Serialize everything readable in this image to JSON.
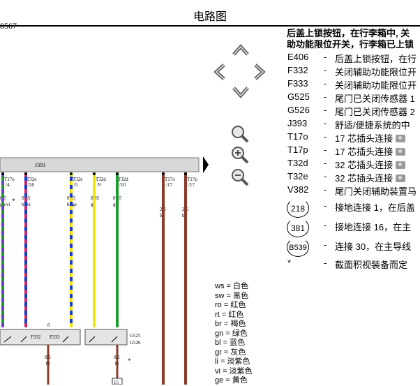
{
  "header": {
    "title": "电路图",
    "doc_number": "8567"
  },
  "diagram": {
    "module_label": "J393",
    "pins": [
      {
        "conn": "T17o",
        "pin": "/4"
      },
      {
        "conn": "T32e",
        "pin": "/20"
      },
      {
        "conn": "T32e",
        "pin": "/5"
      },
      {
        "conn": "T32d",
        "pin": "/9"
      },
      {
        "conn": "T32d",
        "pin": "/10"
      },
      {
        "conn": "T17o",
        "pin": "/17"
      },
      {
        "conn": "T17p",
        "pin": "/17"
      }
    ],
    "wires": [
      {
        "size": "0.35",
        "color": "bl/vi"
      },
      {
        "size": "0.35",
        "color": "bl/ge"
      },
      {
        "size": "0.35",
        "color": "ge"
      },
      {
        "size": "0.35",
        "color": "gn"
      },
      {
        "size": "2.5",
        "color": "br"
      },
      {
        "size": "2.5",
        "color": "br"
      }
    ],
    "left_wire_size": "0.5",
    "left_wire_color": "gn/vi",
    "asterisk": "*",
    "switch_labels": [
      "F332",
      "F333"
    ],
    "sensor_labels": [
      "G525",
      "G526"
    ],
    "lower_wires": [
      {
        "size": "0.5",
        "color": "br"
      },
      {
        "size": "0.5",
        "color": "br"
      }
    ],
    "connector_num": "15",
    "ground_pin_top": "8"
  },
  "nav": {
    "icons": [
      "arrow-up-icon",
      "arrow-left-icon",
      "arrow-right-icon",
      "arrow-down-icon",
      "magnifier-icon",
      "zoom-in-icon",
      "zoom-out-icon",
      "expand-arrow-icon"
    ]
  },
  "legend": {
    "title_line1": "后盖上锁按钮，在行李箱中, 关",
    "title_line2": "助功能限位开关，行李箱已上锁",
    "items": [
      {
        "code": "E406",
        "desc": "后盖上锁按钮，在行"
      },
      {
        "code": "F332",
        "desc": "关闭辅助功能限位开"
      },
      {
        "code": "F333",
        "desc": "关闭辅助功能限位开"
      },
      {
        "code": "G525",
        "desc": "尾门已关闭传感器 1"
      },
      {
        "code": "G526",
        "desc": "尾门已关闭传感器 2"
      },
      {
        "code": "J393",
        "desc": "舒适/便捷系统的中"
      },
      {
        "code": "T17o",
        "desc": "17 芯插头连接"
      },
      {
        "code": "T17p",
        "desc": "17 芯插头连接"
      },
      {
        "code": "T32d",
        "desc": "32 芯插头连接"
      },
      {
        "code": "T32e",
        "desc": "32 芯插头连接"
      },
      {
        "code": "V382",
        "desc": "尾门关闭辅助装置马"
      }
    ],
    "circled": [
      {
        "num": "218",
        "desc": "接地连接 1，在后盖"
      },
      {
        "num": "381",
        "desc": "接地连接 16，在主"
      },
      {
        "num": "B539",
        "desc": "连接 30，在主导线"
      }
    ],
    "footnote": {
      "mark": "*",
      "desc": "截面积视装备而定"
    },
    "dash": "-"
  },
  "color_codes": [
    {
      "code": "ws",
      "name": "白色"
    },
    {
      "code": "sw",
      "name": "黑色"
    },
    {
      "code": "ro",
      "name": "红色"
    },
    {
      "code": "rt",
      "name": "红色"
    },
    {
      "code": "br",
      "name": "褐色"
    },
    {
      "code": "gn",
      "name": "绿色"
    },
    {
      "code": "bl",
      "name": "蓝色"
    },
    {
      "code": "gr",
      "name": "灰色"
    },
    {
      "code": "li",
      "name": "淡紫色"
    },
    {
      "code": "vi",
      "name": "淡紫色"
    },
    {
      "code": "ge",
      "name": "黄色"
    }
  ]
}
